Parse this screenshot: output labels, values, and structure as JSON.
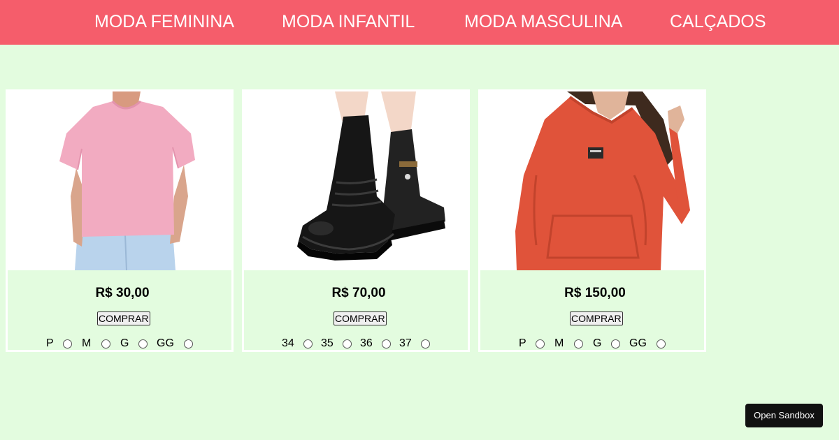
{
  "nav": {
    "items": [
      "MODA FEMININA",
      "MODA INFANTIL",
      "MODA MASCULINA",
      "CALÇADOS"
    ]
  },
  "products": [
    {
      "image": "pink-t-shirt-photo",
      "price": "R$ 30,00",
      "buy_label": "COMPRAR",
      "sizes": [
        "P",
        "M",
        "G",
        "GG"
      ]
    },
    {
      "image": "black-ankle-boots-photo",
      "price": "R$ 70,00",
      "buy_label": "COMPRAR",
      "sizes": [
        "34",
        "35",
        "36",
        "37"
      ]
    },
    {
      "image": "orange-hoodie-photo",
      "price": "R$ 150,00",
      "buy_label": "COMPRAR",
      "sizes": [
        "P",
        "M",
        "G",
        "GG"
      ]
    }
  ],
  "sandbox": {
    "label": "Open Sandbox"
  },
  "colors": {
    "nav_bg": "#f55d6b",
    "page_bg": "#e3fcdf",
    "card_border": "#ffffff"
  }
}
